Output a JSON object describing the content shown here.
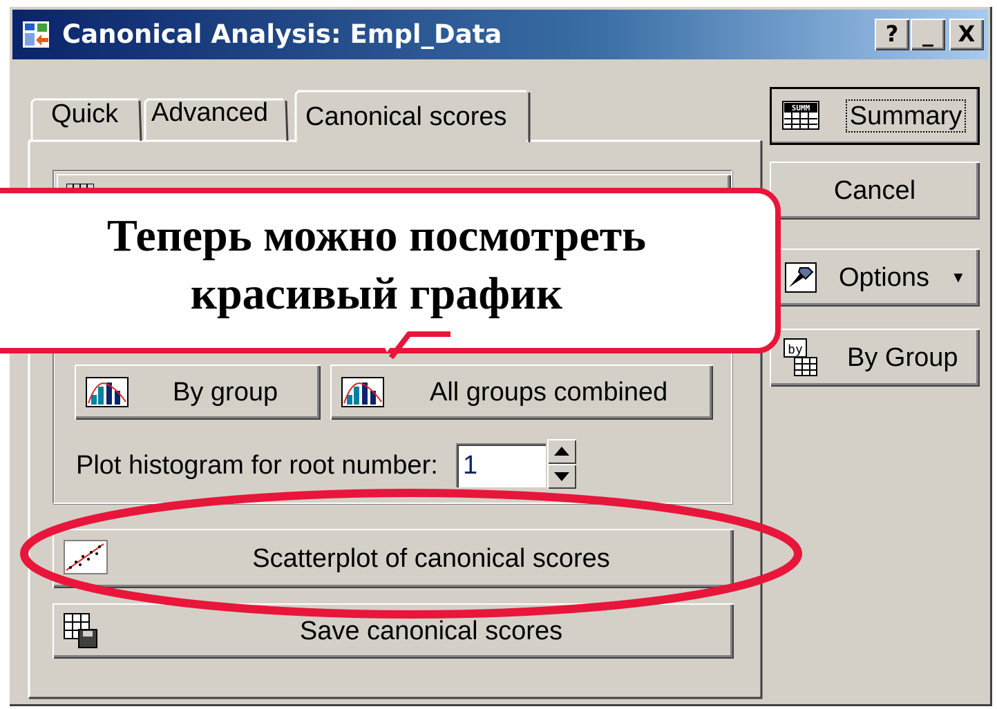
{
  "window": {
    "title": "Canonical Analysis: Empl_Data",
    "controls": {
      "help": "?",
      "minimize": "_",
      "close": "X"
    }
  },
  "tabs": [
    {
      "label": "Quick"
    },
    {
      "label": "Advanced"
    },
    {
      "label": "Canonical scores",
      "active": true
    }
  ],
  "side_buttons": {
    "summary": "Summary",
    "cancel": "Cancel",
    "options": "Options",
    "by_group": "By Group"
  },
  "histogram": {
    "by_group": "By group",
    "all_groups": "All groups combined",
    "root_label": "Plot histogram for root number:",
    "root_value": "1"
  },
  "scores": {
    "scatterplot": "Scatterplot of canonical scores",
    "save": "Save canonical scores"
  },
  "callout": {
    "line1": "Теперь можно посмотреть",
    "line2": "красивый график"
  },
  "colors": {
    "highlight": "#e8163a",
    "titlebar": "#0a246a",
    "face": "#d4d0c8"
  },
  "icons": [
    "app-icon",
    "summary-icon",
    "options-icon",
    "by-group-icon",
    "histogram-icon",
    "scatterplot-icon",
    "save-icon"
  ]
}
